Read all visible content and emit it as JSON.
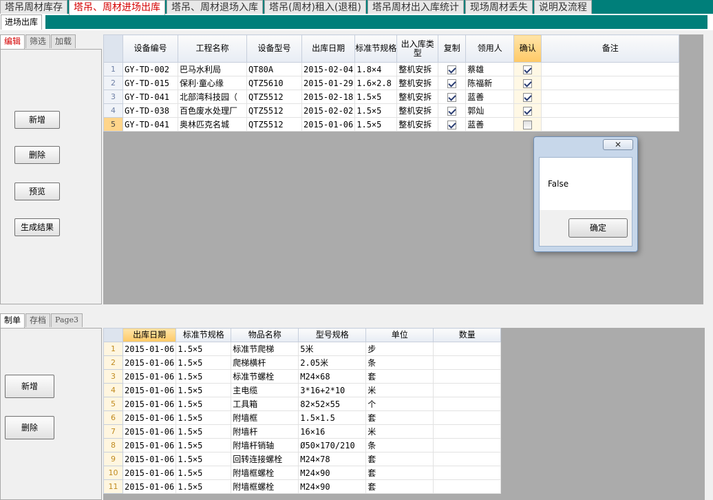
{
  "top_tabs": [
    {
      "label": "塔吊周材库存",
      "active": false
    },
    {
      "label": "塔吊、周材进场出库",
      "active": true
    },
    {
      "label": "塔吊、周材退场入库",
      "active": false
    },
    {
      "label": "塔吊(周材)租入(退租)",
      "active": false
    },
    {
      "label": "塔吊周材出入库统计",
      "active": false
    },
    {
      "label": "现场周材丢失",
      "active": false
    },
    {
      "label": "说明及流程",
      "active": false
    }
  ],
  "sub_tab": "进场出库",
  "upper_panel": {
    "tabs": [
      "编辑",
      "筛选",
      "加载"
    ],
    "buttons": [
      "新增",
      "删除",
      "预览",
      "生成结果"
    ]
  },
  "upper_grid": {
    "headers": [
      "设备编号",
      "工程名称",
      "设备型号",
      "出库日期",
      "标准节规格",
      "出入库类型",
      "复制",
      "领用人",
      "确认",
      "备注"
    ],
    "rows": [
      {
        "num": "1",
        "code": "GY-TD-002",
        "project": "巴马水利局",
        "model": "QT80A",
        "date": "2015-02-04",
        "spec": "1.8×4",
        "type": "整机安拆",
        "copy": true,
        "person": "蔡雄",
        "confirm": true,
        "note": ""
      },
      {
        "num": "2",
        "code": "GY-TD-015",
        "project": "保利·童心缘",
        "model": "QTZ5610",
        "date": "2015-01-29",
        "spec": "1.6×2.8",
        "type": "整机安拆",
        "copy": true,
        "person": "陈福新",
        "confirm": true,
        "note": ""
      },
      {
        "num": "3",
        "code": "GY-TD-041",
        "project": "北部湾科技园（",
        "model": "QTZ5512",
        "date": "2015-02-18",
        "spec": "1.5×5",
        "type": "整机安拆",
        "copy": true,
        "person": "蓝善",
        "confirm": true,
        "note": ""
      },
      {
        "num": "4",
        "code": "GY-TD-038",
        "project": "百色废水处理厂",
        "model": "QTZ5512",
        "date": "2015-02-02",
        "spec": "1.5×5",
        "type": "整机安拆",
        "copy": true,
        "person": "郭灿",
        "confirm": true,
        "note": ""
      },
      {
        "num": "5",
        "code": "GY-TD-041",
        "project": "奥林匹克名城",
        "model": "QTZ5512",
        "date": "2015-01-06",
        "spec": "1.5×5",
        "type": "整机安拆",
        "copy": true,
        "person": "蓝善",
        "confirm": false,
        "note": ""
      }
    ]
  },
  "message_box": {
    "close_label": "✕",
    "text": "False",
    "ok_label": "确定"
  },
  "lower_panel": {
    "tabs": [
      "制单",
      "存档",
      "Page3"
    ],
    "buttons": [
      "新增",
      "删除"
    ]
  },
  "lower_grid": {
    "headers": [
      "出库日期",
      "标准节规格",
      "物品名称",
      "型号规格",
      "单位",
      "数量"
    ],
    "rows": [
      {
        "num": "1",
        "date": "2015-01-06",
        "spec": "1.5×5",
        "item": "标准节爬梯",
        "model": "5米",
        "unit": "步",
        "qty": ""
      },
      {
        "num": "2",
        "date": "2015-01-06",
        "spec": "1.5×5",
        "item": "爬梯横杆",
        "model": "2.05米",
        "unit": "条",
        "qty": ""
      },
      {
        "num": "3",
        "date": "2015-01-06",
        "spec": "1.5×5",
        "item": "标准节螺栓",
        "model": "M24×68",
        "unit": "套",
        "qty": ""
      },
      {
        "num": "4",
        "date": "2015-01-06",
        "spec": "1.5×5",
        "item": "主电缆",
        "model": "3*16+2*10",
        "unit": "米",
        "qty": ""
      },
      {
        "num": "5",
        "date": "2015-01-06",
        "spec": "1.5×5",
        "item": "工具箱",
        "model": "82×52×55",
        "unit": "个",
        "qty": ""
      },
      {
        "num": "6",
        "date": "2015-01-06",
        "spec": "1.5×5",
        "item": "附墙框",
        "model": "1.5×1.5",
        "unit": "套",
        "qty": ""
      },
      {
        "num": "7",
        "date": "2015-01-06",
        "spec": "1.5×5",
        "item": "附墙杆",
        "model": "16×16",
        "unit": "米",
        "qty": ""
      },
      {
        "num": "8",
        "date": "2015-01-06",
        "spec": "1.5×5",
        "item": "附墙杆销轴",
        "model": "Ø50×170/210",
        "unit": "条",
        "qty": ""
      },
      {
        "num": "9",
        "date": "2015-01-06",
        "spec": "1.5×5",
        "item": "回转连接螺栓",
        "model": "M24×78",
        "unit": "套",
        "qty": ""
      },
      {
        "num": "10",
        "date": "2015-01-06",
        "spec": "1.5×5",
        "item": "附墙框螺栓",
        "model": "M24×90",
        "unit": "套",
        "qty": ""
      },
      {
        "num": "11",
        "date": "2015-01-06",
        "spec": "1.5×5",
        "item": "附墙框螺栓",
        "model": "M24×90",
        "unit": "套",
        "qty": ""
      }
    ]
  }
}
